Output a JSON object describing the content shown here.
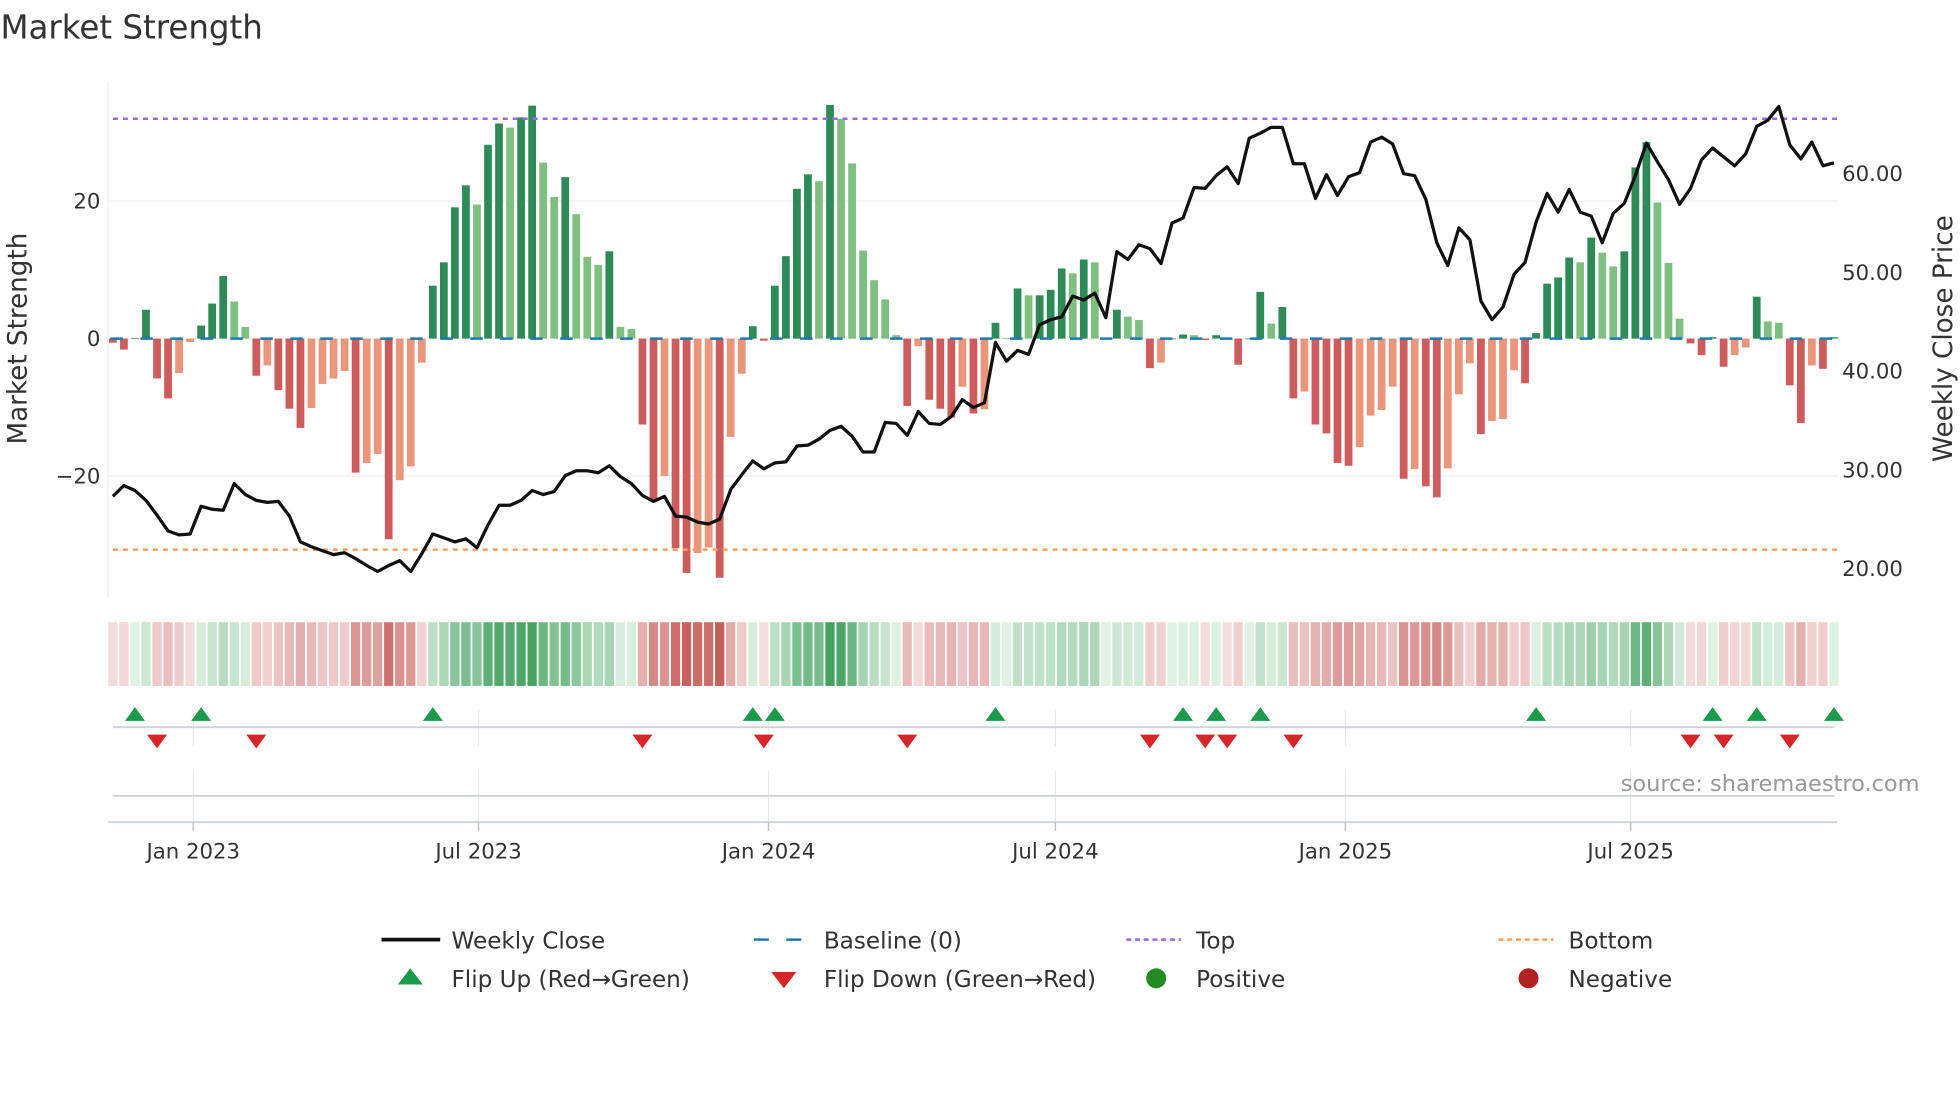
{
  "title": "Market Strength",
  "source": "source: sharemaestro.com",
  "colors": {
    "bar_pos_rising": "#2e8b57",
    "bar_pos_falling": "#7fbf7f",
    "bar_neg_falling": "#cd5c5c",
    "bar_neg_rising": "#e9967a",
    "close_line": "#111111",
    "baseline": "#1f77b4",
    "top": "#9b6be0",
    "bottom": "#f0a060",
    "flip_up": "#1a9a4a",
    "flip_down": "#d62728",
    "positive": "#228b22",
    "negative": "#b22222"
  },
  "legend": {
    "weekly_close": "Weekly Close",
    "baseline": "Baseline (0)",
    "top": "Top",
    "bottom": "Bottom",
    "flip_up": "Flip Up (Red→Green)",
    "flip_down": "Flip Down (Green→Red)",
    "positive": "Positive",
    "negative": "Negative"
  },
  "chart_data": {
    "type": "bar+line",
    "title": "Market Strength",
    "ylabel": "Market Strength",
    "ylabel_right": "Weekly Close Price",
    "start_date": "2022-11-11",
    "frequency": "weekly",
    "top_level": 32,
    "bottom_level": -30.7,
    "baseline": 0,
    "y_left": {
      "range": [
        -38,
        38
      ],
      "ticks": [
        {
          "value": 20,
          "label": "20"
        },
        {
          "value": 0,
          "label": "0"
        },
        {
          "value": -20,
          "label": "−20"
        }
      ]
    },
    "y_right": {
      "range": [
        17,
        69
      ],
      "ticks": [
        {
          "value": 60,
          "label": "60.00"
        },
        {
          "value": 50,
          "label": "50.00"
        },
        {
          "value": 40,
          "label": "40.00"
        },
        {
          "value": 30,
          "label": "30.00"
        },
        {
          "value": 20,
          "label": "20.00"
        }
      ]
    },
    "x_ticks": [
      {
        "date": "2023-01-01",
        "label": "Jan 2023"
      },
      {
        "date": "2023-07-01",
        "label": "Jul 2023"
      },
      {
        "date": "2024-01-01",
        "label": "Jan 2024"
      },
      {
        "date": "2024-07-01",
        "label": "Jul 2024"
      },
      {
        "date": "2025-01-01",
        "label": "Jan 2025"
      },
      {
        "date": "2025-07-01",
        "label": "Jul 2025"
      }
    ],
    "strength": [
      -0.6,
      -1.6,
      0.1,
      4.2,
      -5.8,
      -8.7,
      -5.0,
      -0.5,
      1.9,
      5.1,
      9.1,
      5.4,
      1.7,
      -5.4,
      -3.9,
      -7.5,
      -10.2,
      -13.0,
      -10.1,
      -6.6,
      -5.8,
      -4.7,
      -19.5,
      -18.1,
      -16.8,
      -29.2,
      -20.6,
      -18.6,
      -3.5,
      7.7,
      11.1,
      19.1,
      22.3,
      19.5,
      28.2,
      31.3,
      30.7,
      32.2,
      33.9,
      25.6,
      20.6,
      23.5,
      18.1,
      11.9,
      10.7,
      12.7,
      1.7,
      1.4,
      -12.5,
      -23.4,
      -20.0,
      -30.5,
      -34.1,
      -31.2,
      -30.4,
      -34.8,
      -14.3,
      -5.1,
      1.8,
      -0.3,
      7.7,
      12.0,
      21.8,
      23.9,
      22.9,
      34.0,
      32.0,
      25.5,
      12.8,
      8.5,
      5.7,
      0.5,
      -9.8,
      -1.1,
      -8.9,
      -10.2,
      -11.5,
      -7.0,
      -10.9,
      -10.3,
      2.3,
      0.1,
      7.3,
      6.3,
      6.3,
      7.1,
      10.2,
      9.5,
      11.5,
      11.1,
      0,
      4.2,
      3.2,
      2.7,
      -4.3,
      -3.5,
      0,
      0.6,
      0.5,
      -0.2,
      0.5,
      -0.1,
      -3.8,
      0,
      6.8,
      2.2,
      4.6,
      -8.7,
      -7.7,
      -12.5,
      -13.8,
      -18.1,
      -18.5,
      -15.8,
      -11.2,
      -10.4,
      -7.0,
      -20.4,
      -19.0,
      -21.5,
      -23.1,
      -18.9,
      -8.1,
      -3.6,
      -13.9,
      -12.0,
      -11.7,
      -4.6,
      -6.5,
      0.8,
      8.0,
      8.9,
      11.8,
      11.1,
      14.7,
      12.5,
      10.5,
      12.7,
      24.9,
      28.6,
      19.8,
      11.0,
      2.9,
      -0.7,
      -2.4,
      0.2,
      -4.1,
      -2.4,
      -1.3,
      6.1,
      2.5,
      2.3,
      -6.8,
      -12.3,
      -3.9,
      -4.4,
      0.2
    ],
    "close": [
      27.3,
      28.4,
      27.9,
      26.9,
      25.4,
      23.8,
      23.4,
      23.5,
      26.3,
      26.0,
      25.9,
      28.6,
      27.5,
      26.9,
      26.7,
      26.8,
      25.3,
      22.7,
      22.2,
      21.8,
      21.4,
      21.6,
      21.0,
      20.3,
      19.7,
      20.3,
      20.8,
      19.7,
      21.5,
      23.5,
      23.1,
      22.7,
      23.0,
      22.1,
      24.4,
      26.4,
      26.4,
      26.9,
      27.9,
      27.5,
      27.8,
      29.4,
      29.9,
      29.9,
      29.7,
      30.4,
      29.3,
      28.6,
      27.4,
      26.8,
      27.3,
      25.3,
      25.2,
      24.7,
      24.5,
      25.0,
      28.0,
      29.5,
      30.9,
      30.1,
      30.7,
      30.8,
      32.4,
      32.5,
      33.1,
      34.0,
      34.4,
      33.4,
      31.8,
      31.8,
      34.8,
      34.7,
      33.5,
      35.9,
      34.7,
      34.6,
      35.4,
      37.1,
      36.3,
      36.8,
      42.9,
      41.0,
      42.1,
      41.7,
      44.7,
      45.2,
      45.5,
      47.6,
      47.2,
      47.9,
      45.4,
      52.1,
      51.3,
      52.8,
      52.4,
      50.9,
      55.0,
      55.5,
      58.6,
      58.5,
      59.8,
      60.7,
      59.0,
      63.6,
      64.1,
      64.7,
      64.7,
      61.0,
      61.0,
      57.5,
      59.9,
      57.8,
      59.7,
      60.1,
      63.2,
      63.7,
      63.0,
      60.0,
      59.8,
      57.4,
      53.0,
      50.7,
      54.5,
      53.3,
      47.1,
      45.2,
      46.5,
      49.8,
      51.0,
      55.1,
      58.0,
      56.1,
      58.4,
      56.1,
      55.7,
      53.0,
      56.0,
      57.0,
      59.8,
      63.1,
      61.2,
      59.4,
      56.9,
      58.5,
      61.4,
      62.6,
      61.7,
      60.8,
      62.0,
      64.8,
      65.4,
      66.8,
      62.9,
      61.5,
      63.2,
      60.8,
      61.1
    ],
    "flip_up_index": [
      2,
      8,
      29,
      58,
      60,
      80,
      97,
      100,
      104,
      129,
      145,
      149,
      156
    ],
    "flip_down_index": [
      4,
      13,
      48,
      59,
      72,
      94,
      99,
      101,
      107,
      143,
      146,
      152
    ],
    "legend_position": "bottom",
    "grid": true
  }
}
